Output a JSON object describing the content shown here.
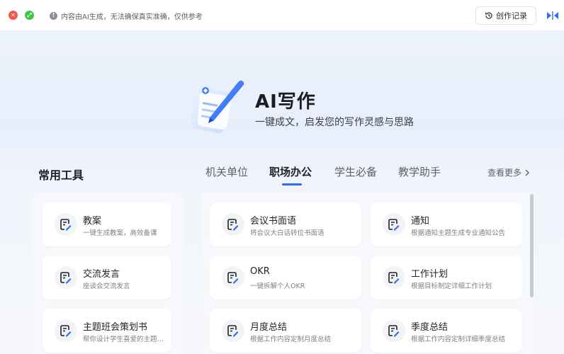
{
  "titlebar": {
    "notice": "内容由AI生成，无法确保真实准确，仅供参考",
    "history_button": "创作记录",
    "icons": {
      "close": "close-icon",
      "maximize": "maximize-icon",
      "info": "info-icon",
      "history": "history-clock-icon",
      "collapse": "collapse-sidebar-icon"
    },
    "colors": {
      "close": "#f2574b",
      "maximize": "#3fc44b"
    }
  },
  "hero": {
    "title": "AI写作",
    "subtitle": "一键成文，启发您的写作灵感与思路"
  },
  "tools": {
    "section_title": "常用工具",
    "tabs": [
      {
        "label": "机关单位",
        "active": false
      },
      {
        "label": "职场办公",
        "active": true
      },
      {
        "label": "学生必备",
        "active": false
      },
      {
        "label": "教学助手",
        "active": false
      }
    ],
    "more_label": "查看更多",
    "accent_color": "#2f6bf5",
    "left_cards": [
      {
        "title": "教案",
        "desc": "一键生成教案，高效备课"
      },
      {
        "title": "交流发言",
        "desc": "座谈会交流发言"
      },
      {
        "title": "主题班会策划书",
        "desc": "帮你设计学生喜爱的主题…"
      }
    ],
    "right_cards": [
      {
        "title": "会议书面语",
        "desc": "将会议大白话转位书面语"
      },
      {
        "title": "通知",
        "desc": "根据通知主题生成专业通知公告"
      },
      {
        "title": "OKR",
        "desc": "一键拆解个人OKR"
      },
      {
        "title": "工作计划",
        "desc": "根据目标制定详细工作计划"
      },
      {
        "title": "月度总结",
        "desc": "根据工作内容定制月度总结"
      },
      {
        "title": "季度总结",
        "desc": "根据工作内容定制详细季度总结"
      }
    ]
  }
}
